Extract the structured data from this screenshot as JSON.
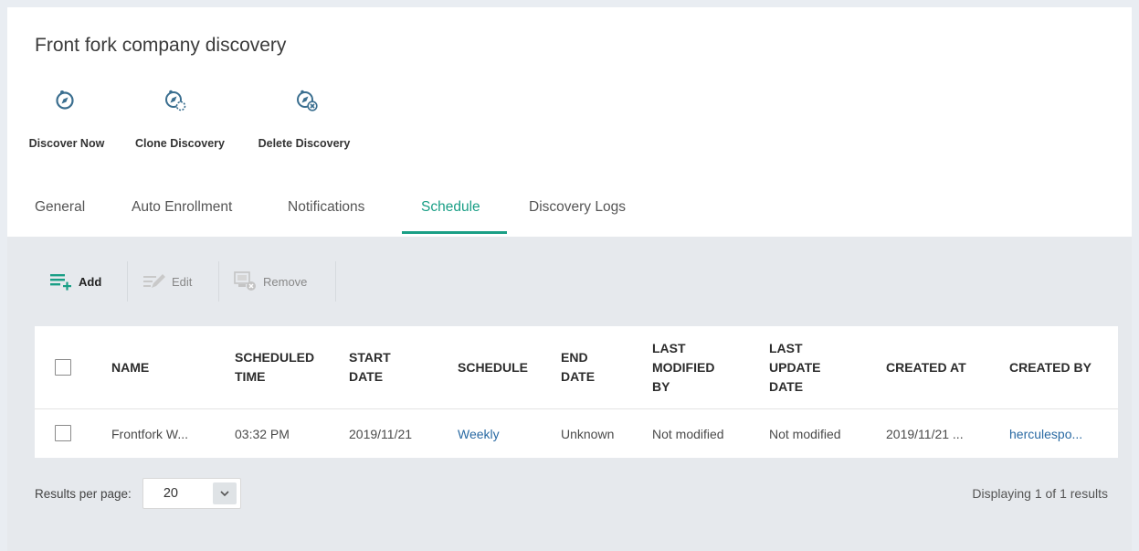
{
  "page": {
    "title": "Front fork company discovery"
  },
  "actions": [
    {
      "label": "Discover Now",
      "icon": "discover-now-icon"
    },
    {
      "label": "Clone Discovery",
      "icon": "clone-discovery-icon"
    },
    {
      "label": "Delete Discovery",
      "icon": "delete-discovery-icon"
    }
  ],
  "tabs": [
    {
      "label": "General"
    },
    {
      "label": "Auto Enrollment"
    },
    {
      "label": "Notifications"
    },
    {
      "label": "Schedule",
      "active": true
    },
    {
      "label": "Discovery Logs"
    }
  ],
  "toolbar": {
    "add_label": "Add",
    "edit_label": "Edit",
    "remove_label": "Remove"
  },
  "table": {
    "headers": {
      "name": "NAME",
      "scheduled_time_1": "SCHEDULED",
      "scheduled_time_2": "TIME",
      "start_date_1": "START",
      "start_date_2": "DATE",
      "schedule": "SCHEDULE",
      "end_date_1": "END",
      "end_date_2": "DATE",
      "last_modified_1": "LAST",
      "last_modified_2": "MODIFIED",
      "last_modified_3": "BY",
      "last_update_1": "LAST",
      "last_update_2": "UPDATE",
      "last_update_3": "DATE",
      "created_at": "CREATED AT",
      "created_by": "CREATED BY"
    },
    "rows": [
      {
        "name": "Frontfork W...",
        "scheduled_time": "03:32 PM",
        "start_date": "2019/11/21",
        "schedule": "Weekly",
        "end_date": "Unknown",
        "last_modified_by": "Not modified",
        "last_update_date": "Not modified",
        "created_at": "2019/11/21 ...",
        "created_by": "herculespo..."
      }
    ]
  },
  "footer": {
    "results_per_page_label": "Results per page:",
    "results_per_page_value": "20",
    "displaying": "Displaying 1 of 1 results"
  },
  "colors": {
    "accent": "#1a9f86",
    "link": "#2a6aa3",
    "icon": "#3a6e8f",
    "add_icon": "#1a9f86"
  }
}
